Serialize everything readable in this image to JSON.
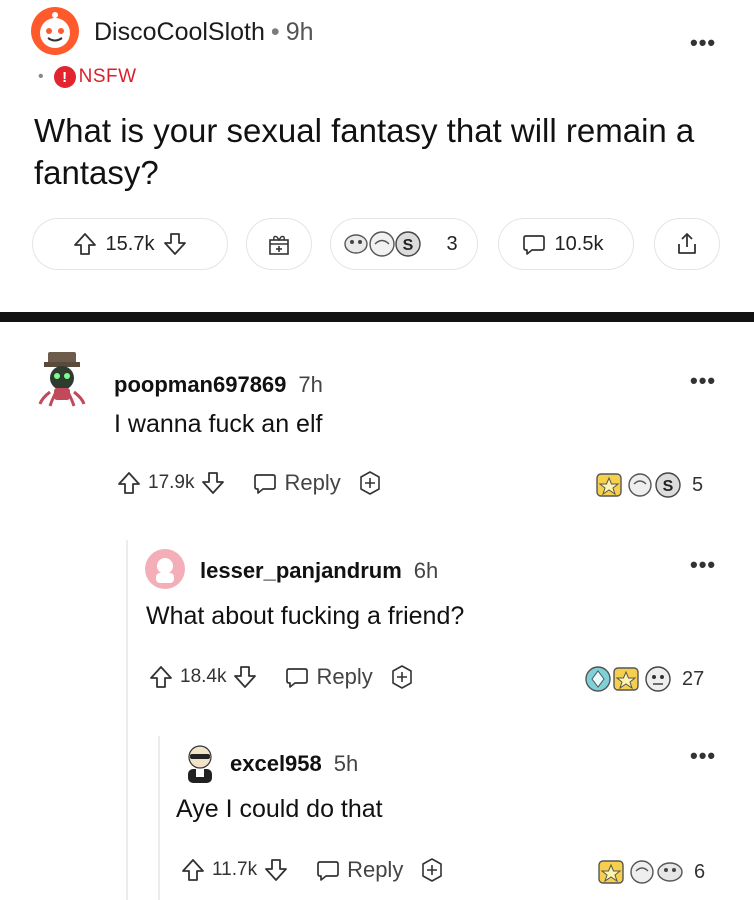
{
  "post": {
    "username": "DiscoCoolSloth",
    "separator": "•",
    "time": "9h",
    "nsfw_label": "NSFW",
    "title": "What is your sexual fantasy that will remain a fantasy?",
    "upvotes": "15.7k",
    "awards_count": "3",
    "comments_count": "10.5k",
    "more_label": "•••"
  },
  "comments": [
    {
      "username": "poopman697869",
      "time": "7h",
      "body": "I wanna fuck an elf",
      "upvotes": "17.9k",
      "reply_label": "Reply",
      "awards_count": "5",
      "more_label": "•••"
    },
    {
      "username": "lesser_panjandrum",
      "time": "6h",
      "body": "What about fucking a friend?",
      "upvotes": "18.4k",
      "reply_label": "Reply",
      "awards_count": "27",
      "more_label": "•••"
    },
    {
      "username": "excel958",
      "time": "5h",
      "body": "Aye I could do that",
      "upvotes": "11.7k",
      "reply_label": "Reply",
      "awards_count": "6",
      "more_label": "•••"
    }
  ],
  "colors": {
    "nsfw": "#d9202c",
    "divider": "#121212",
    "text": "#1a1a1b"
  }
}
